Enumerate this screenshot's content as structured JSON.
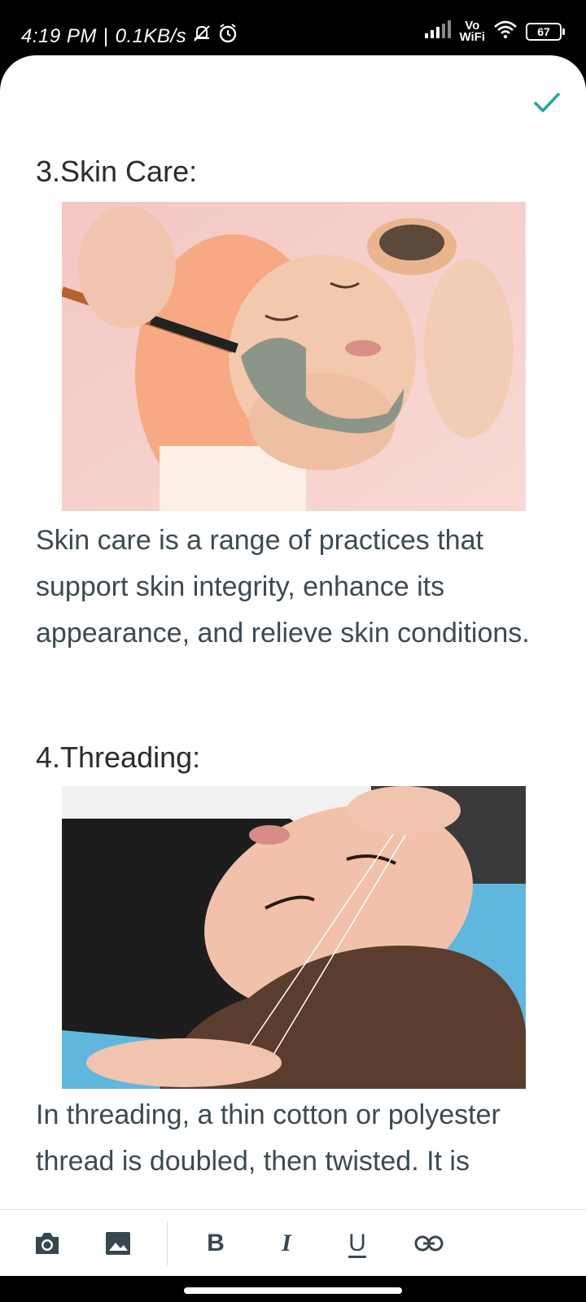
{
  "status_bar": {
    "time": "4:19 PM",
    "separator": "|",
    "speed": "0.1KB/s",
    "vowifi_top": "Vo",
    "vowifi_bottom": "WiFi",
    "battery": "67"
  },
  "editor": {
    "sections": [
      {
        "heading": "3.Skin Care:",
        "image_desc": "facial-mask-photo",
        "text": "Skin care is a range of practices that support skin integrity, enhance its appearance, and relieve skin conditions."
      },
      {
        "heading": "4.Threading:",
        "image_desc": "threading-photo",
        "text": "In threading, a thin cotton or polyester thread is doubled, then twisted. It is"
      }
    ]
  },
  "toolbar": {
    "bold": "B",
    "italic": "I",
    "underline": "U"
  },
  "colors": {
    "accent": "#26a69a",
    "text": "#37474f"
  }
}
